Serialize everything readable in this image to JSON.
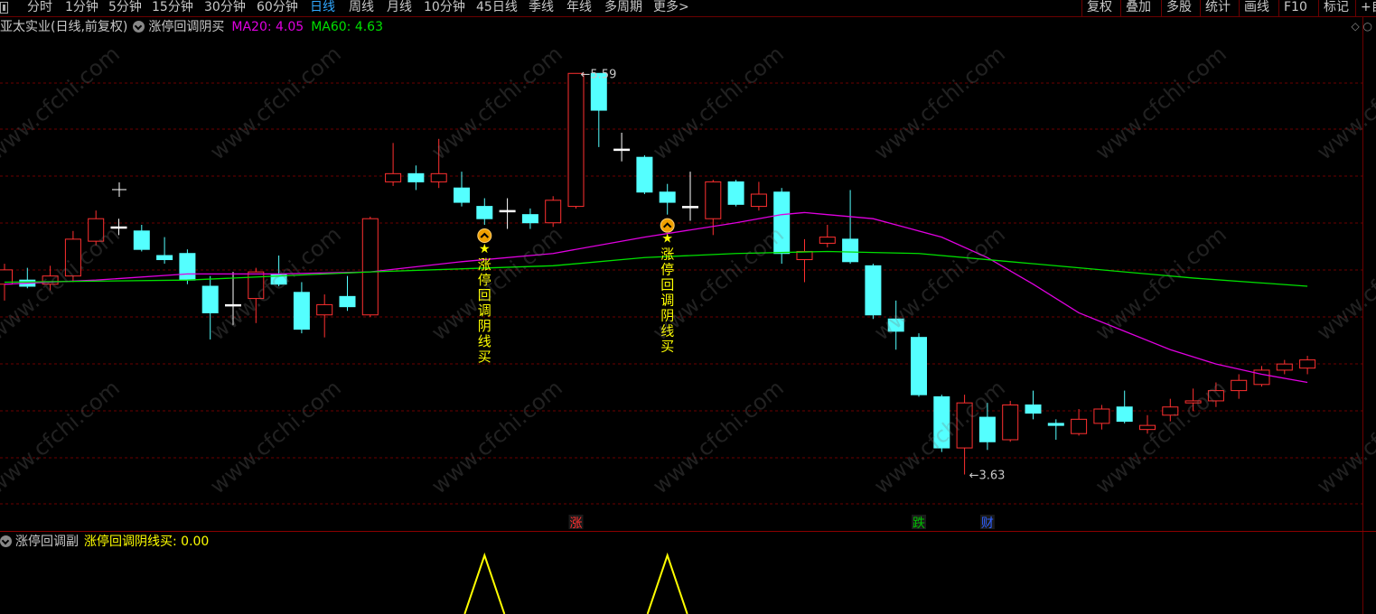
{
  "toolbar": {
    "periods": [
      "分时",
      "1分钟",
      "5分钟",
      "15分钟",
      "30分钟",
      "60分钟",
      "日线",
      "周线",
      "月线",
      "10分钟",
      "45日线",
      "季线",
      "年线",
      "多周期",
      "更多>"
    ],
    "active_period": "日线",
    "right_buttons": [
      "复权",
      "叠加",
      "多股",
      "统计",
      "画线",
      "F10",
      "标记",
      "+自"
    ]
  },
  "header": {
    "stock_title": "亚太实业(日线,前复权)",
    "formula_name": "涨停回调阴买",
    "ma20_text": "MA20: 4.05",
    "ma60_text": "MA60: 4.63",
    "corner_icons": "◇ ○"
  },
  "subpanel": {
    "name": "涨停回调副",
    "value_text": "涨停回调阴线买: 0.00"
  },
  "colors": {
    "up": "#ff3030",
    "down": "#54ffff",
    "ma20": "#e000e0",
    "ma60": "#00e000",
    "signal": "#ffff00",
    "grid": "#6b0000"
  },
  "chart_data": {
    "type": "candlestick",
    "title": "亚太实业(日线,前复权)",
    "y_range": [
      3.5,
      5.75
    ],
    "grid": "horizontal dashed lines",
    "candles": [
      {
        "o": 4.56,
        "c": 4.63,
        "h": 4.66,
        "l": 4.48
      },
      {
        "o": 4.58,
        "c": 4.55,
        "h": 4.64,
        "l": 4.54
      },
      {
        "o": 4.56,
        "c": 4.6,
        "h": 4.65,
        "l": 4.53
      },
      {
        "o": 4.6,
        "c": 4.78,
        "h": 4.82,
        "l": 4.57
      },
      {
        "o": 4.77,
        "c": 4.88,
        "h": 4.92,
        "l": 4.75
      },
      {
        "o": 4.84,
        "c": 4.84,
        "h": 4.88,
        "l": 4.8
      },
      {
        "o": 4.82,
        "c": 4.73,
        "h": 4.85,
        "l": 4.72
      },
      {
        "o": 4.7,
        "c": 4.68,
        "h": 4.79,
        "l": 4.66
      },
      {
        "o": 4.71,
        "c": 4.58,
        "h": 4.73,
        "l": 4.56
      },
      {
        "o": 4.55,
        "c": 4.42,
        "h": 4.6,
        "l": 4.29
      },
      {
        "o": 4.46,
        "c": 4.46,
        "h": 4.62,
        "l": 4.36
      },
      {
        "o": 4.49,
        "c": 4.62,
        "h": 4.64,
        "l": 4.37
      },
      {
        "o": 4.61,
        "c": 4.56,
        "h": 4.7,
        "l": 4.55
      },
      {
        "o": 4.52,
        "c": 4.34,
        "h": 4.57,
        "l": 4.32
      },
      {
        "o": 4.41,
        "c": 4.46,
        "h": 4.51,
        "l": 4.3
      },
      {
        "o": 4.5,
        "c": 4.45,
        "h": 4.6,
        "l": 4.43
      },
      {
        "o": 4.41,
        "c": 4.88,
        "h": 4.89,
        "l": 4.4
      },
      {
        "o": 5.06,
        "c": 5.1,
        "h": 5.25,
        "l": 5.04
      },
      {
        "o": 5.1,
        "c": 5.06,
        "h": 5.14,
        "l": 5.02
      },
      {
        "o": 5.06,
        "c": 5.1,
        "h": 5.27,
        "l": 5.03
      },
      {
        "o": 5.03,
        "c": 4.96,
        "h": 5.11,
        "l": 4.94
      },
      {
        "o": 4.94,
        "c": 4.88,
        "h": 4.98,
        "l": 4.85
      },
      {
        "o": 4.92,
        "c": 4.92,
        "h": 4.98,
        "l": 4.83
      },
      {
        "o": 4.9,
        "c": 4.86,
        "h": 4.93,
        "l": 4.83
      },
      {
        "o": 4.86,
        "c": 4.97,
        "h": 4.99,
        "l": 4.84
      },
      {
        "o": 4.94,
        "c": 5.59,
        "h": 5.59,
        "l": 4.93
      },
      {
        "o": 5.59,
        "c": 5.41,
        "h": 5.59,
        "l": 5.23
      },
      {
        "o": 5.22,
        "c": 5.22,
        "h": 5.3,
        "l": 5.16
      },
      {
        "o": 5.18,
        "c": 5.01,
        "h": 5.19,
        "l": 5.0
      },
      {
        "o": 5.01,
        "c": 4.96,
        "h": 5.05,
        "l": 4.9
      },
      {
        "o": 4.94,
        "c": 4.94,
        "h": 5.11,
        "l": 4.87
      },
      {
        "o": 4.88,
        "c": 5.06,
        "h": 5.07,
        "l": 4.8
      },
      {
        "o": 5.06,
        "c": 4.95,
        "h": 5.07,
        "l": 4.94
      },
      {
        "o": 4.94,
        "c": 5.0,
        "h": 5.06,
        "l": 4.92
      },
      {
        "o": 5.01,
        "c": 4.71,
        "h": 5.03,
        "l": 4.66
      },
      {
        "o": 4.68,
        "c": 4.72,
        "h": 4.78,
        "l": 4.57
      },
      {
        "o": 4.76,
        "c": 4.79,
        "h": 4.85,
        "l": 4.74
      },
      {
        "o": 4.78,
        "c": 4.67,
        "h": 5.02,
        "l": 4.66
      },
      {
        "o": 4.65,
        "c": 4.41,
        "h": 4.66,
        "l": 4.39
      },
      {
        "o": 4.39,
        "c": 4.33,
        "h": 4.48,
        "l": 4.24
      },
      {
        "o": 4.3,
        "c": 4.02,
        "h": 4.32,
        "l": 4.01
      },
      {
        "o": 4.01,
        "c": 3.76,
        "h": 4.02,
        "l": 3.74
      },
      {
        "o": 3.76,
        "c": 3.98,
        "h": 4.02,
        "l": 3.63
      },
      {
        "o": 3.91,
        "c": 3.79,
        "h": 3.98,
        "l": 3.75
      },
      {
        "o": 3.8,
        "c": 3.97,
        "h": 3.99,
        "l": 3.79
      },
      {
        "o": 3.97,
        "c": 3.93,
        "h": 4.04,
        "l": 3.9
      },
      {
        "o": 3.88,
        "c": 3.87,
        "h": 3.9,
        "l": 3.8
      },
      {
        "o": 3.83,
        "c": 3.9,
        "h": 3.95,
        "l": 3.82
      },
      {
        "o": 3.88,
        "c": 3.95,
        "h": 3.97,
        "l": 3.85
      },
      {
        "o": 3.96,
        "c": 3.89,
        "h": 4.04,
        "l": 3.88
      },
      {
        "o": 3.85,
        "c": 3.87,
        "h": 3.92,
        "l": 3.83
      },
      {
        "o": 3.92,
        "c": 3.96,
        "h": 4.0,
        "l": 3.89
      },
      {
        "o": 3.98,
        "c": 3.99,
        "h": 4.05,
        "l": 3.94
      },
      {
        "o": 3.99,
        "c": 4.04,
        "h": 4.08,
        "l": 3.96
      },
      {
        "o": 4.04,
        "c": 4.09,
        "h": 4.12,
        "l": 4.0
      },
      {
        "o": 4.07,
        "c": 4.14,
        "h": 4.16,
        "l": 4.06
      },
      {
        "o": 4.14,
        "c": 4.17,
        "h": 4.19,
        "l": 4.12
      },
      {
        "o": 4.15,
        "c": 4.19,
        "h": 4.21,
        "l": 4.12
      }
    ],
    "ma_series": [
      {
        "name": "MA20",
        "points": [
          [
            0,
            4.56
          ],
          [
            4,
            4.58
          ],
          [
            8,
            4.61
          ],
          [
            12,
            4.61
          ],
          [
            16,
            4.62
          ],
          [
            20,
            4.67
          ],
          [
            24,
            4.71
          ],
          [
            28,
            4.79
          ],
          [
            32,
            4.86
          ],
          [
            34,
            4.9
          ],
          [
            35,
            4.91
          ],
          [
            36,
            4.9
          ],
          [
            38,
            4.88
          ],
          [
            39,
            4.85
          ],
          [
            41,
            4.79
          ],
          [
            43,
            4.69
          ],
          [
            45,
            4.56
          ],
          [
            47,
            4.42
          ],
          [
            49,
            4.33
          ],
          [
            51,
            4.24
          ],
          [
            53,
            4.17
          ],
          [
            55,
            4.12
          ],
          [
            57,
            4.08
          ]
        ]
      },
      {
        "name": "MA60",
        "points": [
          [
            0,
            4.57
          ],
          [
            8,
            4.58
          ],
          [
            16,
            4.62
          ],
          [
            24,
            4.65
          ],
          [
            28,
            4.69
          ],
          [
            32,
            4.71
          ],
          [
            36,
            4.72
          ],
          [
            40,
            4.71
          ],
          [
            44,
            4.67
          ],
          [
            48,
            4.63
          ],
          [
            52,
            4.59
          ],
          [
            57,
            4.55
          ]
        ]
      }
    ],
    "annotations": [
      {
        "index": 25,
        "price": 5.59,
        "text": "5.59",
        "kind": "high"
      },
      {
        "index": 42,
        "price": 3.63,
        "text": "3.63",
        "kind": "low"
      }
    ],
    "signals": [
      {
        "index": 21,
        "text": "涨停回调阴线买"
      },
      {
        "index": 29,
        "text": "涨停回调阴线买"
      }
    ],
    "markers": [
      {
        "index": 25,
        "text": "涨",
        "color": "#ff3030"
      },
      {
        "index": 40,
        "text": "跌",
        "color": "#00c000"
      },
      {
        "index": 43,
        "text": "财",
        "color": "#3060ff"
      }
    ],
    "sub_series": {
      "name": "涨停回调阴线买",
      "peaks": [
        21,
        29
      ]
    }
  }
}
